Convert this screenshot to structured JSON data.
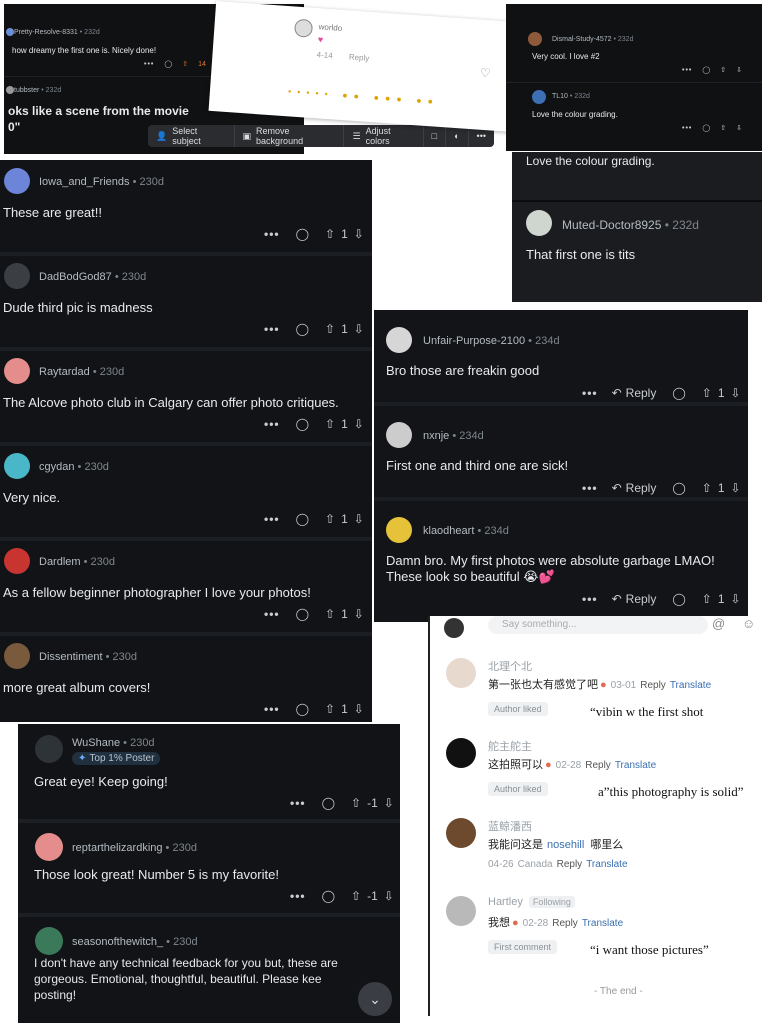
{
  "top_left": {
    "c1": {
      "user": "Pretty-Resolve-8331",
      "age": "232d",
      "text": "how dreamy the first one is. Nicely done!"
    },
    "c2": {
      "user": "tubbster",
      "age": "232d",
      "text1": "oks like a scene from the movie",
      "text2": "0\""
    }
  },
  "toolbar": {
    "select_subject": "Select subject",
    "remove_bg": "Remove background",
    "adjust_colors": "Adjust colors"
  },
  "white_popup": {
    "user": "worldo",
    "date": "4-14",
    "reply": "Reply"
  },
  "top_right": {
    "c1": {
      "user": "Dismal-Study-4572",
      "age": "232d",
      "text": "Very cool. I love #2"
    },
    "c2": {
      "user": "TL10",
      "age": "232d",
      "text": "Love the colour grading."
    }
  },
  "mid_right": {
    "text_top": "Love the colour grading.",
    "c1": {
      "user": "Muted-Doctor8925",
      "age": "232d",
      "text": "That first one is tits"
    }
  },
  "left_list": [
    {
      "user": "Iowa_and_Friends",
      "age": "230d",
      "text": "These are great!!",
      "votes": "1"
    },
    {
      "user": "DadBodGod87",
      "age": "230d",
      "text": "Dude third pic is madness",
      "votes": "1"
    },
    {
      "user": "Raytardad",
      "age": "230d",
      "text": "The Alcove photo club in Calgary can offer photo critiques.",
      "votes": "1"
    },
    {
      "user": "cgydan",
      "age": "230d",
      "text": "Very nice.",
      "votes": "1"
    },
    {
      "user": "Dardlem",
      "age": "230d",
      "text": "As a fellow beginner photographer I love your photos!",
      "votes": "1"
    },
    {
      "user": "Dissentiment",
      "age": "230d",
      "text": "more great album covers!",
      "votes": "1"
    }
  ],
  "right_list": [
    {
      "user": "Unfair-Purpose-2100",
      "age": "234d",
      "text": "Bro those are freakin good",
      "reply": "Reply",
      "votes": "1"
    },
    {
      "user": "nxnje",
      "age": "234d",
      "text": "First one and third one are sick!",
      "reply": "Reply",
      "votes": "1"
    },
    {
      "user": "klaodheart",
      "age": "234d",
      "text1": "Damn bro. My first photos were absolute garbage LMAO!",
      "text2": "These look so beautiful 😭💕",
      "reply": "Reply",
      "votes": "1"
    }
  ],
  "bottom_list": [
    {
      "user": "WuShane",
      "age": "230d",
      "badge": "Top 1% Poster",
      "text": "Great eye! Keep going!",
      "votes": "-1"
    },
    {
      "user": "reptarthelizardking",
      "age": "230d",
      "text": "Those look great! Number 5 is my favorite!",
      "votes": "-1"
    },
    {
      "user": "seasonofthewitch_",
      "age": "230d",
      "text1": "I don't have any technical feedback for you but, these are",
      "text2": "gorgeous. Emotional, thoughtful, beautiful. Please kee",
      "text3": "posting!"
    }
  ],
  "chinese_panel": {
    "input_placeholder": "Say something...",
    "comments": [
      {
        "user": "北理个北",
        "text": "第一张也太有感觉了吧",
        "date": "03-01",
        "reply": "Reply",
        "translate": "Translate",
        "chip": "Author liked",
        "note": "“vibin w the first shot"
      },
      {
        "user": "舵主舵主",
        "text": "这拍照可以",
        "date": "02-28",
        "reply": "Reply",
        "translate": "Translate",
        "chip": "Author liked",
        "note": "a”this photography is solid”"
      },
      {
        "user": "蓝鲸潘西",
        "text": "我能问这是",
        "mention": "nosehill",
        "text_after": "哪里么",
        "date": "04-26",
        "location": "Canada",
        "reply": "Reply",
        "translate": "Translate"
      },
      {
        "user": "Hartley",
        "following": "Following",
        "text": "我想",
        "date": "02-28",
        "reply": "Reply",
        "translate": "Translate",
        "chip": "First comment",
        "note": "“i want those pictures”"
      }
    ],
    "end": "- The end -"
  },
  "colors": {
    "bg_dark": "#0f1113",
    "text": "#e8eaed",
    "muted": "#7e868d",
    "link": "#3a6fb0"
  }
}
